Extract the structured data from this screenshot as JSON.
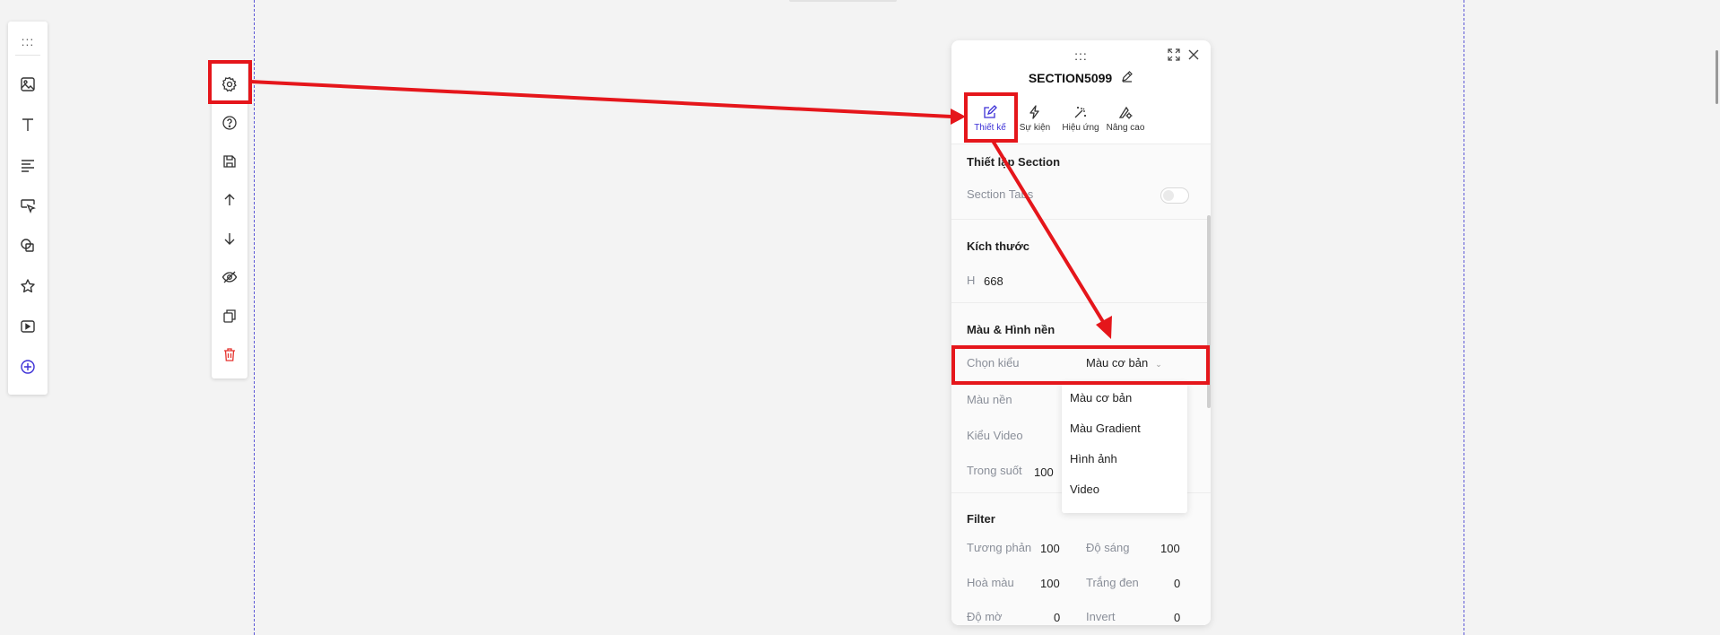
{
  "toolbar_left": {
    "items": [
      {
        "icon": "image-icon"
      },
      {
        "icon": "text-icon"
      },
      {
        "icon": "paragraph-icon"
      },
      {
        "icon": "button-cursor-icon"
      },
      {
        "icon": "shapes-icon"
      },
      {
        "icon": "star-icon"
      },
      {
        "icon": "video-icon"
      },
      {
        "icon": "add-circle-icon"
      }
    ],
    "accent_color": "#3b2fd6"
  },
  "section_toolbar": {
    "items": [
      {
        "icon": "gear-icon"
      },
      {
        "icon": "help-icon"
      },
      {
        "icon": "save-icon"
      },
      {
        "icon": "arrow-up-icon"
      },
      {
        "icon": "arrow-down-icon"
      },
      {
        "icon": "eye-off-icon"
      },
      {
        "icon": "copy-icon"
      },
      {
        "icon": "trash-icon"
      }
    ],
    "delete_color": "#e5322d"
  },
  "panel": {
    "title": "SECTION5099",
    "tabs": [
      {
        "label": "Thiết kế",
        "icon": "edit-icon",
        "active": true
      },
      {
        "label": "Sự kiện",
        "icon": "lightning-icon",
        "active": false
      },
      {
        "label": "Hiệu ứng",
        "icon": "magic-wand-icon",
        "active": false
      },
      {
        "label": "Nâng cao",
        "icon": "advanced-settings-icon",
        "active": false
      }
    ],
    "section_setup": {
      "title": "Thiết lập Section",
      "tabs_label": "Section Tabs",
      "tabs_enabled": false
    },
    "size": {
      "title": "Kích thước",
      "h_label": "H",
      "h_value": "668"
    },
    "color_bg": {
      "title": "Màu & Hình nền",
      "type_label": "Chọn kiểu",
      "type_value": "Màu cơ bản",
      "bg_color_label": "Màu nền",
      "video_type_label": "Kiểu Video",
      "opacity_label": "Trong suốt",
      "opacity_value": "100"
    },
    "dropdown": {
      "options": [
        "Màu cơ bản",
        "Màu Gradient",
        "Hình ảnh",
        "Video"
      ]
    },
    "filter": {
      "title": "Filter",
      "contrast_label": "Tương phản",
      "contrast_value": "100",
      "brightness_label": "Độ sáng",
      "brightness_value": "100",
      "saturation_label": "Hoà màu",
      "saturation_value": "100",
      "grayscale_label": "Trắng đen",
      "grayscale_value": "0",
      "blur_label": "Độ mờ",
      "blur_value": "0",
      "invert_label": "Invert",
      "invert_value": "0"
    }
  },
  "annotation_color": "#e5161b"
}
